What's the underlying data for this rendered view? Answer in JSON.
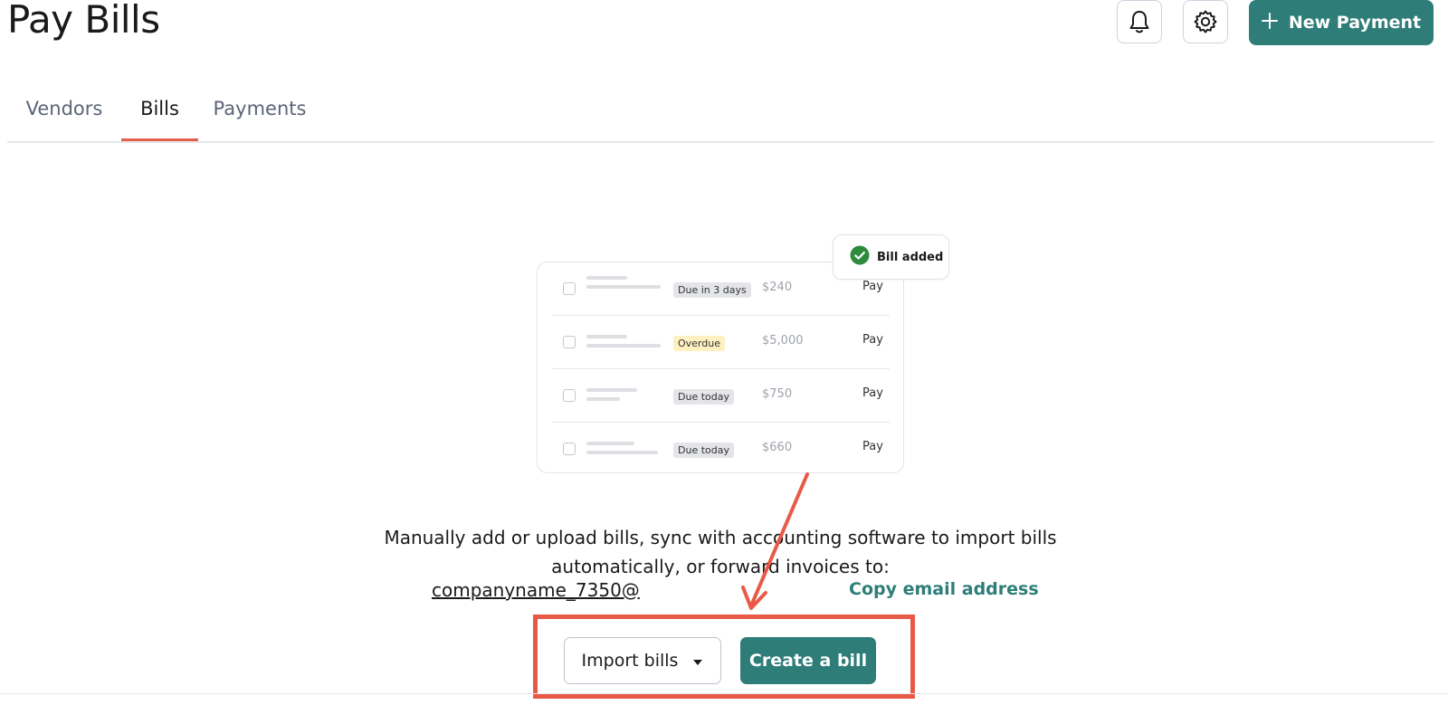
{
  "header": {
    "title": "Pay Bills",
    "notifications_icon": "bell-icon",
    "settings_icon": "gear-icon",
    "new_payment_label": "New Payment",
    "new_payment_icon": "plus-icon"
  },
  "tabs": [
    {
      "label": "Vendors",
      "active": false
    },
    {
      "label": "Bills",
      "active": true
    },
    {
      "label": "Payments",
      "active": false
    }
  ],
  "illustration": {
    "toast": {
      "label": "Bill added",
      "icon": "check-circle-icon"
    },
    "rows": [
      {
        "status": "Due in 3 days",
        "amount": "$240",
        "action": "Pay"
      },
      {
        "status": "Overdue",
        "amount": "$5,000",
        "action": "Pay"
      },
      {
        "status": "Due today",
        "amount": "$750",
        "action": "Pay"
      },
      {
        "status": "Due today",
        "amount": "$660",
        "action": "Pay"
      }
    ]
  },
  "empty_state": {
    "description_line1": "Manually add or upload bills, sync with accounting software to import bills",
    "description_line2": "automatically, or forward invoices to:",
    "email": "companyname_7350@",
    "copy_label": "Copy email address"
  },
  "actions": {
    "import_label": "Import bills",
    "import_icon": "caret-down-icon",
    "create_label": "Create a bill"
  },
  "colors": {
    "brand": "#2e7d78",
    "active_tab_underline": "#e4604d",
    "annotation": "#e85a47",
    "success": "#2e8b3e",
    "overdue_pill": "#fff0c2"
  }
}
